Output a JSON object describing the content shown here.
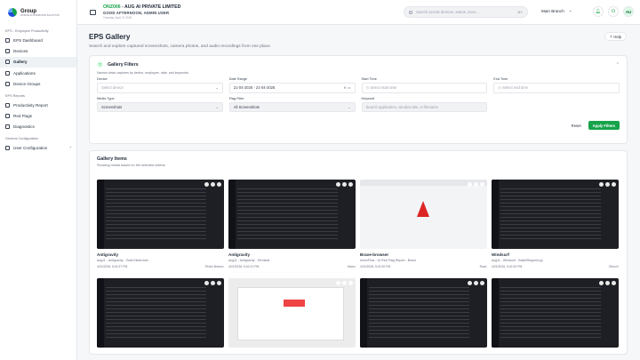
{
  "brand": {
    "name": "Group",
    "tagline": "OFFICE AUTOMATION SOLUTION"
  },
  "sidebar": {
    "sections": [
      {
        "title": "EPS - Employee Productivity",
        "items": [
          {
            "label": "EPS Dashboard",
            "icon": "dashboard-icon"
          },
          {
            "label": "Devices",
            "icon": "device-icon"
          },
          {
            "label": "Gallery",
            "icon": "gallery-icon",
            "active": true
          },
          {
            "label": "Applications",
            "icon": "apps-icon"
          },
          {
            "label": "Device Groups",
            "icon": "group-icon"
          }
        ]
      },
      {
        "title": "EPS Reports",
        "items": [
          {
            "label": "Productivity Report",
            "icon": "report-icon"
          },
          {
            "label": "Red Flags",
            "icon": "flag-icon"
          },
          {
            "label": "Diagnostics",
            "icon": "diagnostics-icon"
          }
        ]
      },
      {
        "title": "General Configuration",
        "items": [
          {
            "label": "User Configuration",
            "icon": "user-icon"
          }
        ]
      }
    ]
  },
  "topbar": {
    "org_code": "ONZ006",
    "org_name": "- AUG AI PRIVATE LIMITED",
    "greeting": "GOOD AFTERNOON, ADMIN USER",
    "date": "Tuesday, April 21 2026",
    "search_placeholder": "Search across devices, teams, docs...",
    "shortcut": "⌘K",
    "branch": "Main Branch",
    "avatar": "AU"
  },
  "page": {
    "title": "EPS Gallery",
    "subtitle": "Search and explore captured screenshots, camera photos, and audio recordings from one place.",
    "help": "Help"
  },
  "filters": {
    "title": "Gallery Filters",
    "subtitle": "Narrow down captures by device, employee, date, and keywords.",
    "device_label": "Device",
    "device_ph": "Select device",
    "date_label": "Date Range",
    "date_value": "21-04-2026 - 21-04-2026",
    "start_label": "Start Time",
    "start_ph": "Select start time",
    "end_label": "End Time",
    "end_ph": "Select end time",
    "media_label": "Media Type",
    "media_value": "Screenshots",
    "flag_label": "Flag Filter",
    "flag_value": "All Screenshots",
    "keyword_label": "Keyword",
    "keyword_ph": "Search application, window title, or filename",
    "reset": "Reset",
    "apply": "Apply Filters"
  },
  "gallery": {
    "title": "Gallery Items",
    "subtitle": "Showing media based on the selected criteria",
    "items": [
      {
        "app": "Antigravity",
        "meta": "aug11 - Antigravity - TeamViewLines",
        "time": "4/21/2026, 5:42:27 PM",
        "user": "Pedro Branco",
        "style": "dark"
      },
      {
        "app": "Antigravity",
        "meta": "aug11 - Antigravity - Terminal",
        "time": "4/21/2026, 5:42:21 PM",
        "user": "Manu",
        "style": "dark"
      },
      {
        "app": "Brave-browser",
        "meta": "InvenFlow - UI Red Flag Report - Brave",
        "time": "4/21/2026, 5:42:20 PM",
        "user": "Rose",
        "style": "brave"
      },
      {
        "app": "Windsurf",
        "meta": "aug11 - Windsurf - BatchRequest.py",
        "time": "4/21/2026, 5:42:20 PM",
        "user": "Dhruvil",
        "style": "dark"
      },
      {
        "app": "",
        "meta": "",
        "time": "",
        "user": "",
        "style": "dark"
      },
      {
        "app": "",
        "meta": "",
        "time": "",
        "user": "",
        "style": "multi"
      },
      {
        "app": "",
        "meta": "",
        "time": "",
        "user": "",
        "style": "dark"
      },
      {
        "app": "",
        "meta": "",
        "time": "",
        "user": "",
        "style": "dark"
      }
    ]
  }
}
